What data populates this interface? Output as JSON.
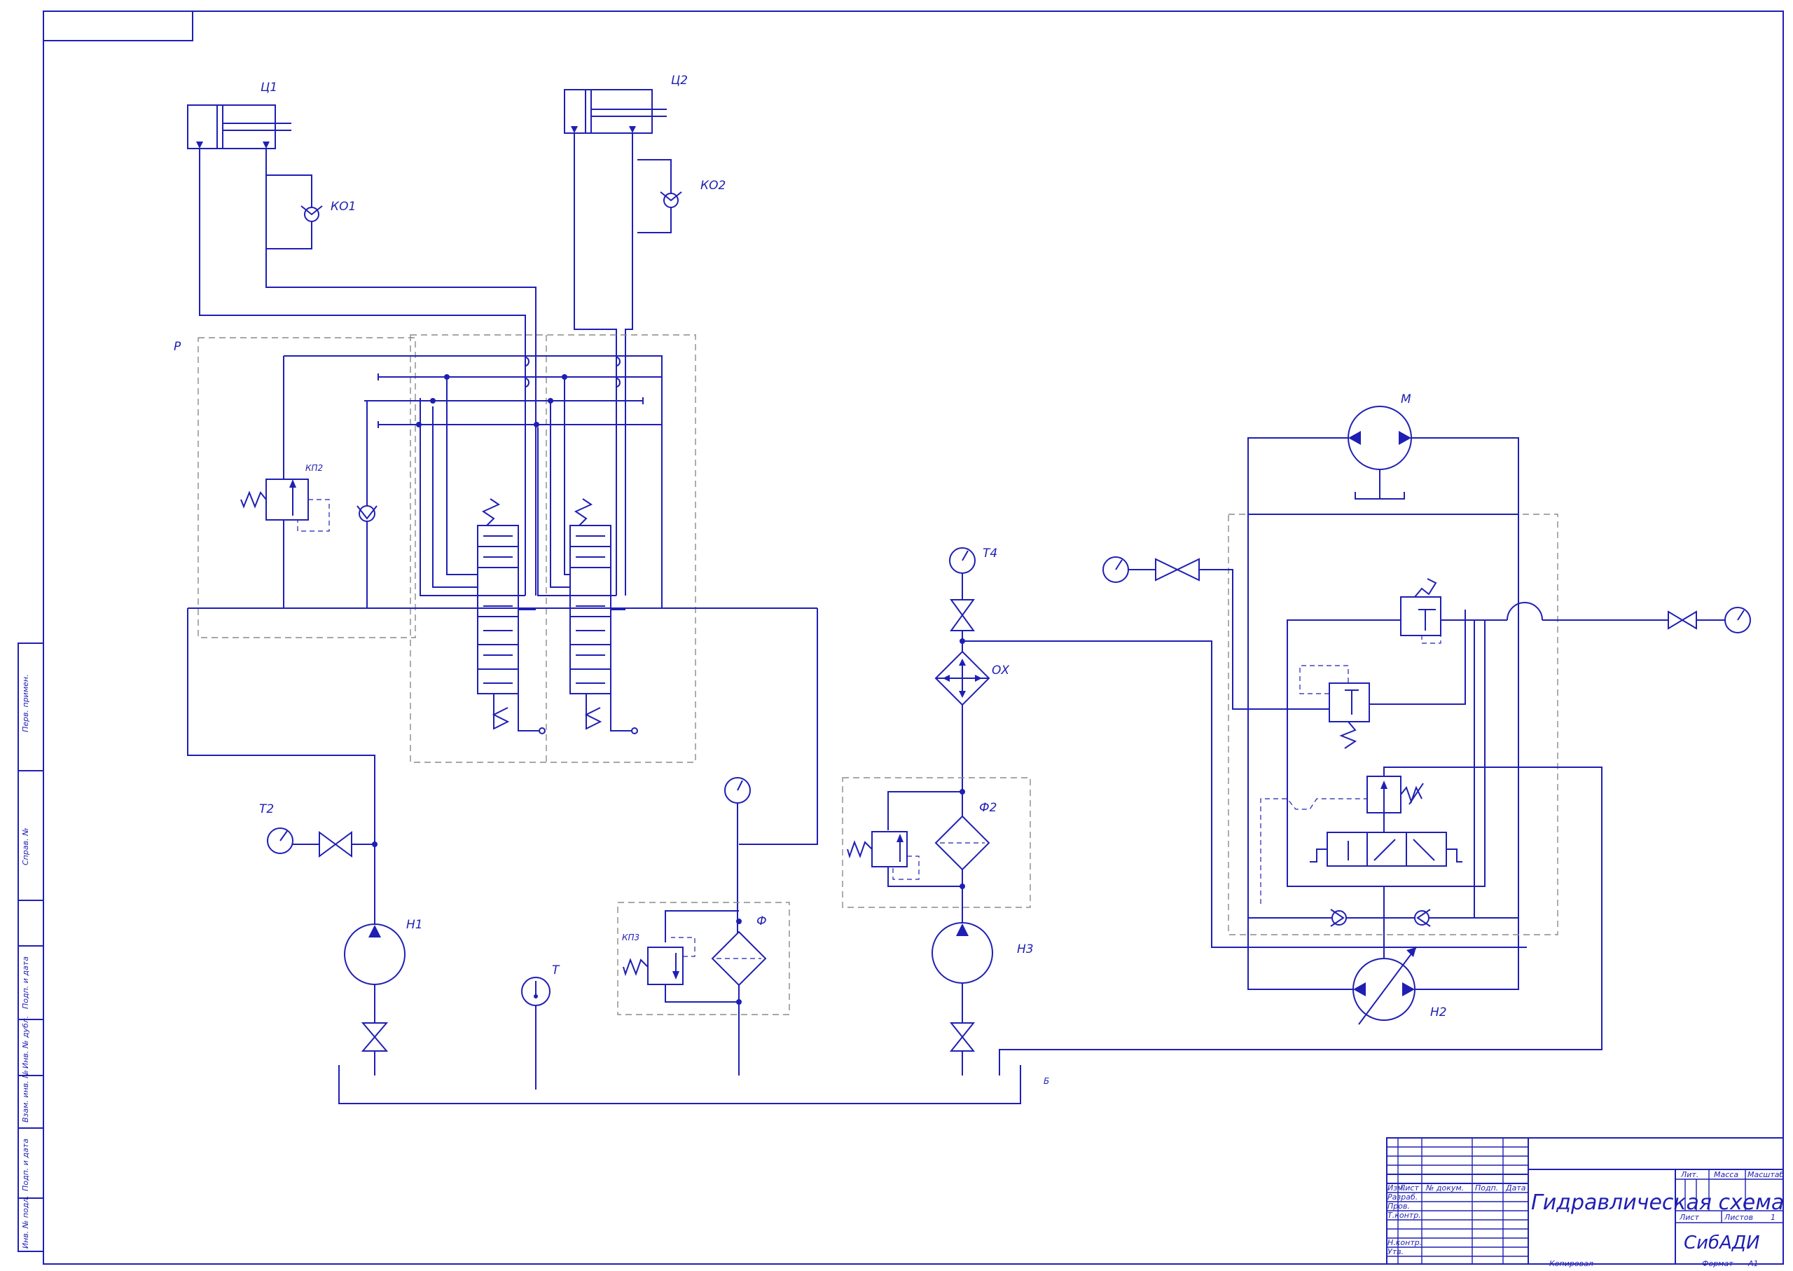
{
  "labels": {
    "c1": "Ц1",
    "c2": "Ц2",
    "ko1": "КО1",
    "ko2": "КО2",
    "p": "Р",
    "kp2": "КП2",
    "m": "М",
    "t4": "Т4",
    "ox": "ОХ",
    "f2": "Ф2",
    "t2": "Т2",
    "h1": "Н1",
    "t": "Т",
    "kp3": "КП3",
    "f": "Ф",
    "h3": "Н3",
    "h2": "Н2",
    "b": "Б"
  },
  "side_stamp": [
    "Перв. примен.",
    "Справ. №",
    "Подп. и дата",
    "Инв. № дубл.",
    "Взам. инв. №",
    "Подп. и дата",
    "Инв. № подл."
  ],
  "title_block": {
    "col_headers": [
      "Изм.",
      "Лист",
      "№ докум.",
      "Подп.",
      "Дата"
    ],
    "rows": [
      "Разраб.",
      "Пров.",
      "Т.контр.",
      "",
      "Н.контр.",
      "Утв."
    ],
    "title": "Гидравлическая схема",
    "lit": "Лит.",
    "mass": "Масса",
    "scale": "Масштаб",
    "sheet": "Лист",
    "sheets": "Листов",
    "sheets_count": "1",
    "org": "СибАДИ",
    "copied": "Копировал",
    "format": "Формат",
    "format_value": "А1"
  }
}
